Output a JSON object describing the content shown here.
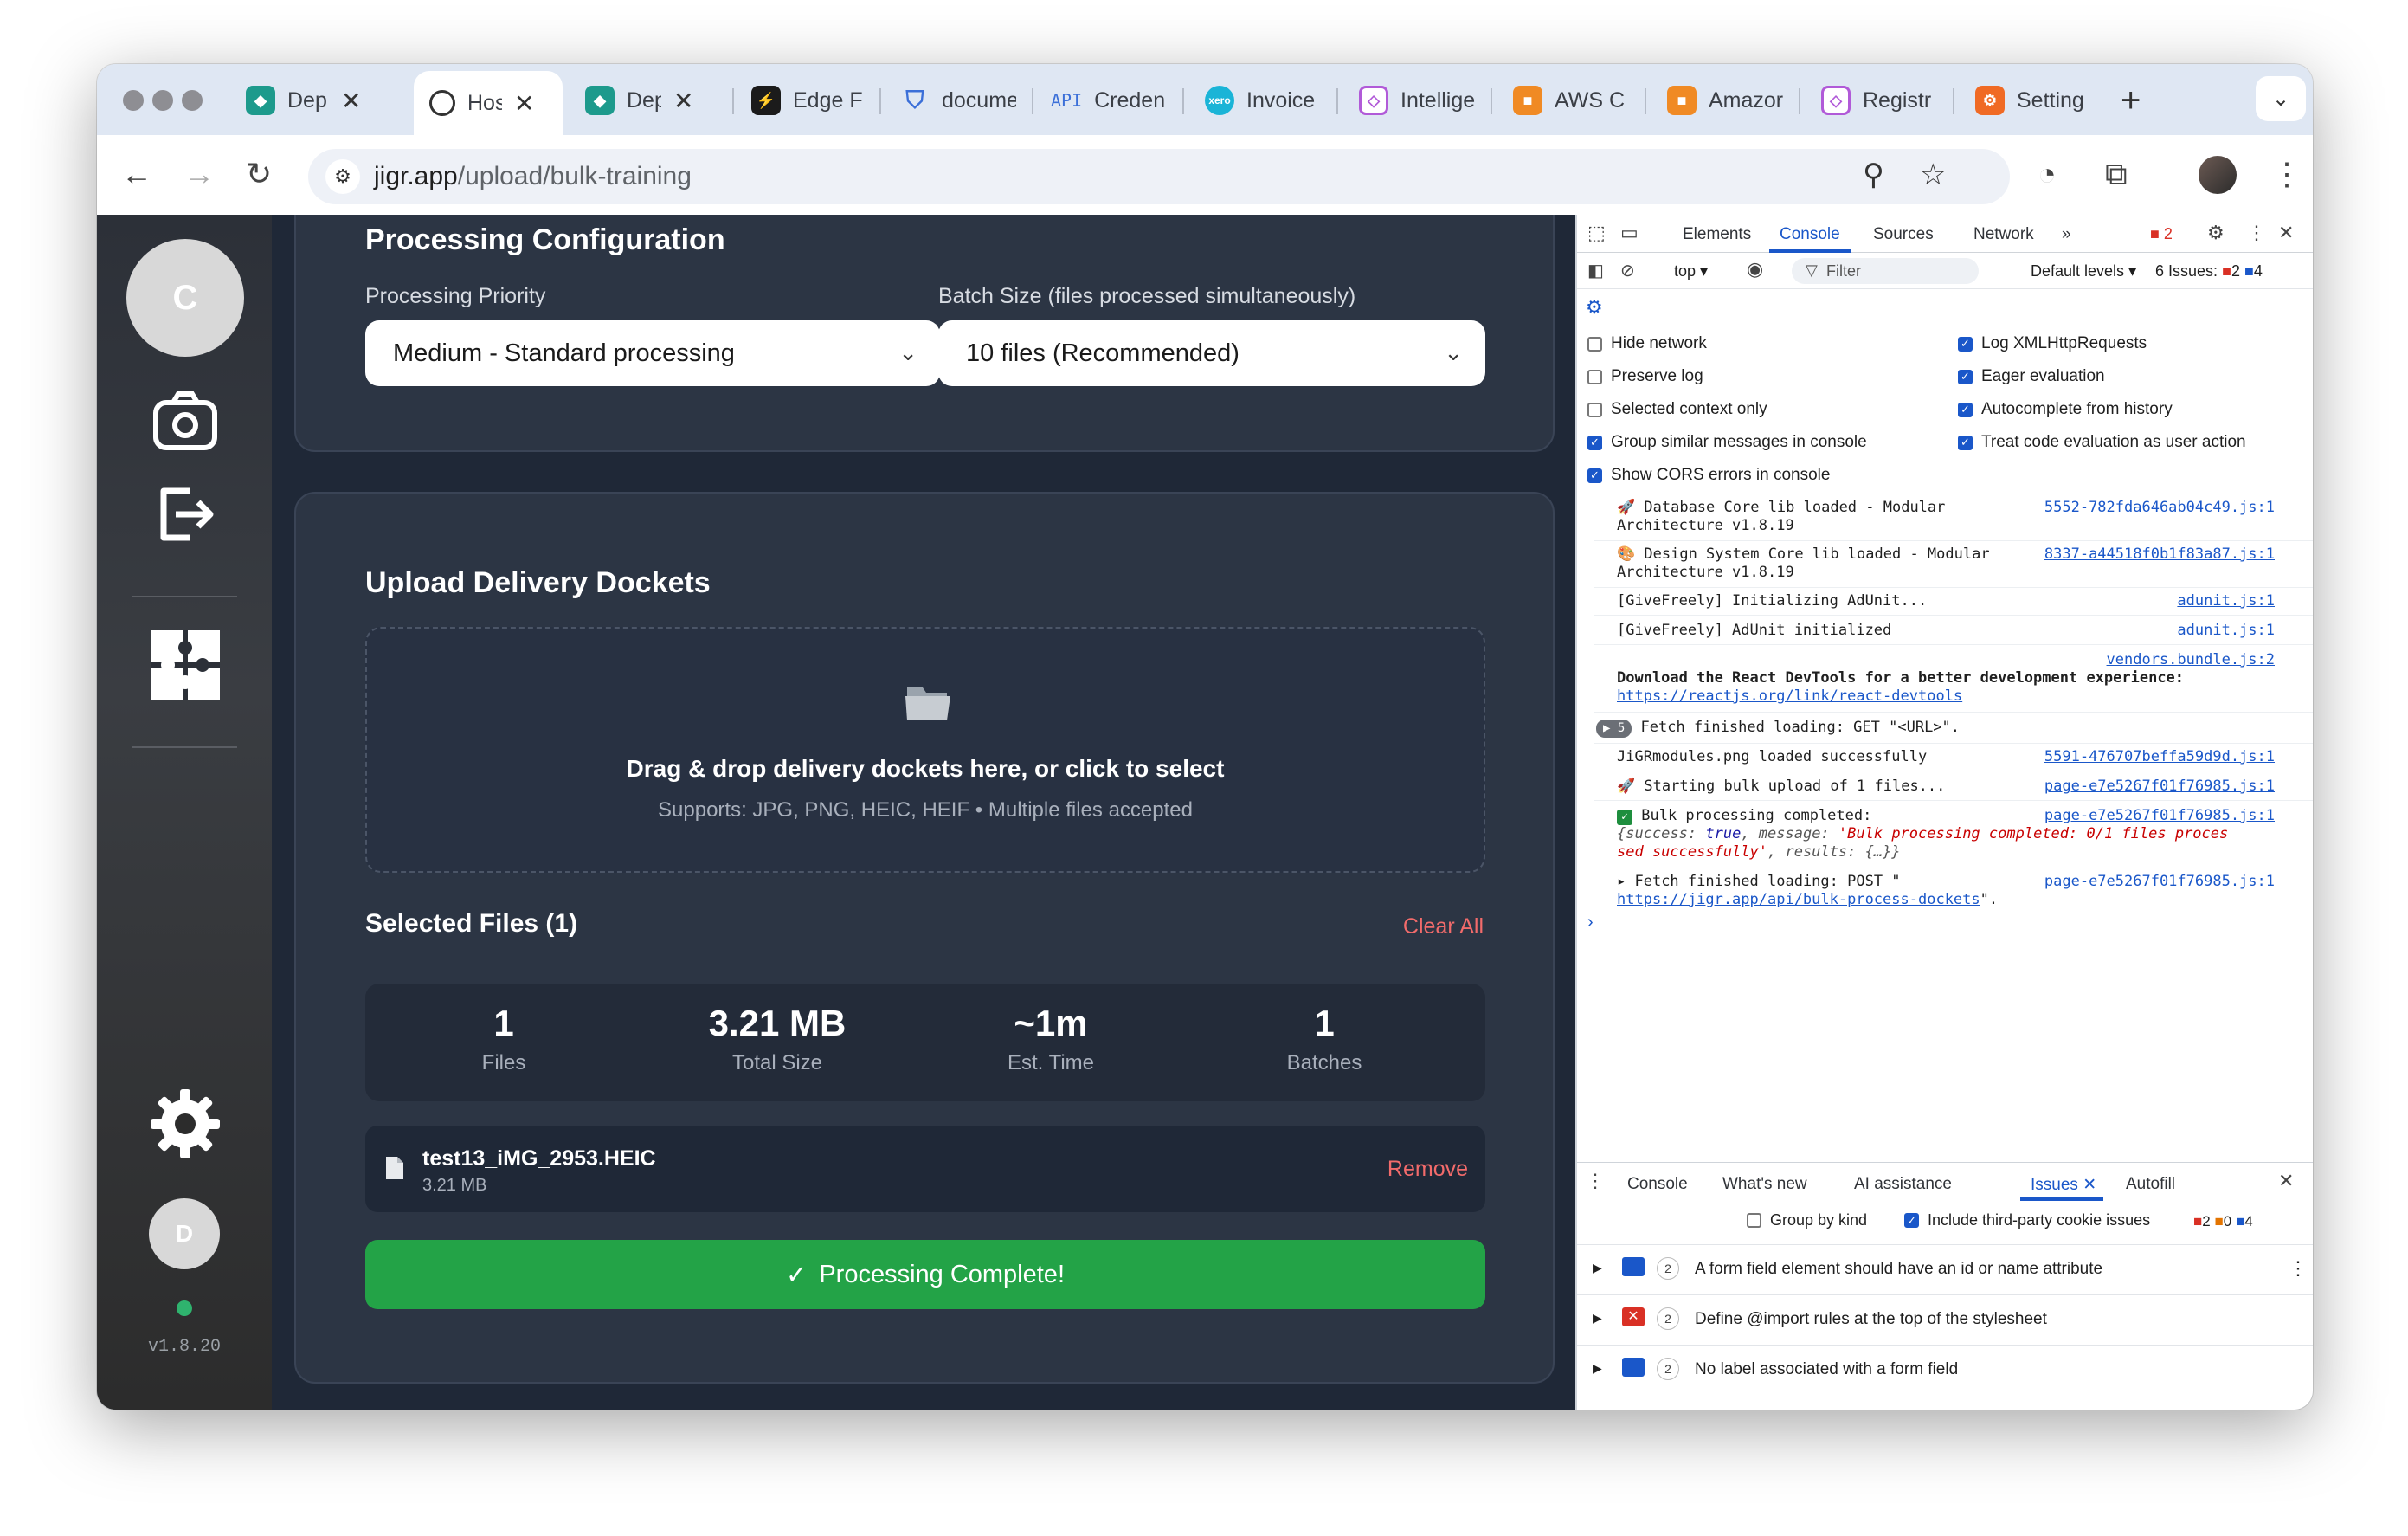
{
  "browser": {
    "tabs": [
      {
        "title": "Dep",
        "icon": "docket-icon",
        "color": "#1d9a8c",
        "closable": true
      },
      {
        "title": "Hos",
        "icon": "globe-icon",
        "color": "#333333",
        "closable": true,
        "active": true
      },
      {
        "title": "Dep",
        "icon": "docket-icon",
        "color": "#1d9a8c",
        "closable": true
      },
      {
        "title": "Edge F",
        "icon": "edge-functions-icon",
        "color": "#1b1b1b"
      },
      {
        "title": "docume",
        "icon": "shield-icon",
        "color": "#3b6fd8"
      },
      {
        "title": "Creden",
        "icon": "api-icon",
        "color": "#3b6fd8",
        "prefix": "API"
      },
      {
        "title": "Invoice",
        "icon": "xero-icon",
        "color": "#1ab4d7"
      },
      {
        "title": "Intellige",
        "icon": "cube-icon",
        "color": "#b15ad8"
      },
      {
        "title": "AWS C",
        "icon": "aws-cube-icon",
        "color": "#f08a24"
      },
      {
        "title": "Amazor",
        "icon": "aws-cube-icon",
        "color": "#f08a24"
      },
      {
        "title": "Registr",
        "icon": "cube-icon",
        "color": "#b15ad8"
      },
      {
        "title": "Setting",
        "icon": "settings-app-icon",
        "color": "#f06a24"
      }
    ],
    "url_domain": "jigr.app",
    "url_path": "/upload/bulk-training"
  },
  "sidebar": {
    "avatar_letter": "C",
    "user_letter": "D",
    "version": "v1.8.20"
  },
  "config": {
    "title": "Processing Configuration",
    "priority_label": "Processing Priority",
    "priority_value": "Medium - Standard processing",
    "batch_label": "Batch Size (files processed simultaneously)",
    "batch_value": "10 files (Recommended)"
  },
  "upload": {
    "title": "Upload Delivery Dockets",
    "dropzone_title": "Drag & drop delivery dockets here, or click to select",
    "dropzone_sub": "Supports: JPG, PNG, HEIC, HEIF • Multiple files accepted",
    "selected_title": "Selected Files (1)",
    "clear_all": "Clear All",
    "stats": [
      {
        "value": "1",
        "label": "Files"
      },
      {
        "value": "3.21 MB",
        "label": "Total Size"
      },
      {
        "value": "~1m",
        "label": "Est. Time"
      },
      {
        "value": "1",
        "label": "Batches"
      }
    ],
    "file": {
      "name": "test13_iMG_2953.HEIC",
      "size": "3.21 MB",
      "remove": "Remove"
    },
    "complete_button": "Processing Complete!"
  },
  "devtools": {
    "tabs": [
      "Elements",
      "Console",
      "Sources",
      "Network"
    ],
    "error_count": "2",
    "context": "top",
    "filter_placeholder": "Filter",
    "levels": "Default levels",
    "issues_label": "6 Issues:",
    "issues_err": "2",
    "issues_info": "4",
    "settings_left": [
      {
        "label": "Hide network",
        "checked": false
      },
      {
        "label": "Preserve log",
        "checked": false
      },
      {
        "label": "Selected context only",
        "checked": false
      },
      {
        "label": "Group similar messages in console",
        "checked": true
      },
      {
        "label": "Show CORS errors in console",
        "checked": true
      }
    ],
    "settings_right": [
      {
        "label": "Log XMLHttpRequests",
        "checked": true
      },
      {
        "label": "Eager evaluation",
        "checked": true
      },
      {
        "label": "Autocomplete from history",
        "checked": true
      },
      {
        "label": "Treat code evaluation as user action",
        "checked": true
      }
    ],
    "logs": {
      "l1a": "🚀 Database Core lib loaded - Modular",
      "l1b": "Architecture v1.8.19",
      "l1src": "5552-782fda646ab04c49.js:1",
      "l2a": "🎨 Design System Core lib loaded - Modular",
      "l2b": "Architecture v1.8.19",
      "l2src": "8337-a44518f0b1f83a87.js:1",
      "l3": "[GiveFreely] Initializing AdUnit...",
      "l3src": "adunit.js:1",
      "l4": "[GiveFreely] AdUnit initialized",
      "l4src": "adunit.js:1",
      "l5src": "vendors.bundle.js:2",
      "l5a": "Download the React DevTools for a better development experience:",
      "l5b": "https://reactjs.org/link/react-devtools",
      "l6count": "5",
      "l6": "Fetch finished loading: GET \"<URL>\".",
      "l7": "JiGRmodules.png loaded successfully",
      "l7src": "5591-476707beffa59d9d.js:1",
      "l8": "🚀 Starting bulk upload of 1 files...",
      "l8src": "page-e7e5267f01f76985.js:1",
      "l9": "Bulk processing completed:",
      "l9src": "page-e7e5267f01f76985.js:1",
      "l9b_key1": "{success: ",
      "l9b_val1": "true",
      "l9b_key2": ", message: ",
      "l9b_val2": "'Bulk processing completed: 0/1 files proces",
      "l9c_val": "sed successfully'",
      "l9c_rest": ", results: {…}}",
      "l10a": "Fetch finished loading: POST \"",
      "l10b": "https://jigr.app/api/bulk-process-dockets",
      "l10c": "\".",
      "l10src": "page-e7e5267f01f76985.js:1"
    },
    "drawer_tabs": [
      "Console",
      "What's new",
      "AI assistance",
      "Issues",
      "Autofill"
    ],
    "group_by_kind": "Group by kind",
    "third_party": "Include third-party cookie issues",
    "drawer_counts": {
      "err": "2",
      "warn": "0",
      "info": "4"
    },
    "issues": [
      {
        "count": "2",
        "text": "A form field element should have an id or name attribute",
        "kind": "info"
      },
      {
        "count": "2",
        "text": "Define @import rules at the top of the stylesheet",
        "kind": "error"
      },
      {
        "count": "2",
        "text": "No label associated with a form field",
        "kind": "info"
      }
    ]
  }
}
